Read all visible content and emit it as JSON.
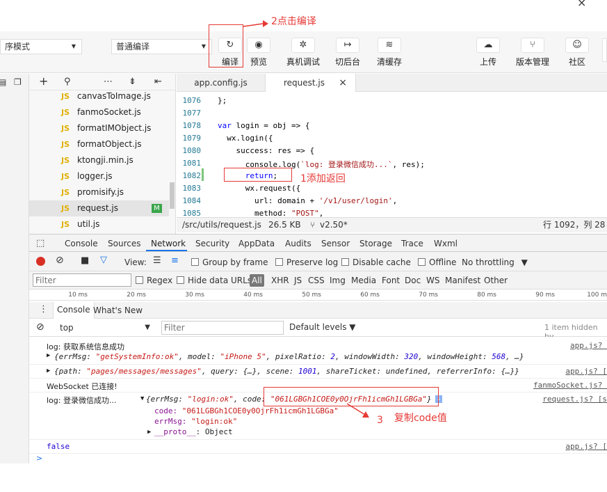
{
  "title_close": "×",
  "toolbar": {
    "mode_select": "序模式",
    "compile_select": "普通编译",
    "buttons": [
      {
        "icon": "↻",
        "label": "编译"
      },
      {
        "icon": "◉",
        "label": "预览"
      },
      {
        "icon": "✲",
        "label": "真机调试"
      },
      {
        "icon": "↦",
        "label": "切后台"
      },
      {
        "icon": "≋",
        "label": "清缓存"
      },
      {
        "icon": "☁",
        "label": "上传"
      },
      {
        "icon": "⑂",
        "label": "版本管理"
      },
      {
        "icon": "☺",
        "label": "社区"
      }
    ]
  },
  "annotations": {
    "a1": "1添加返回",
    "a2": "2点击编译",
    "a3_num": "3",
    "a3_text": "复制code值"
  },
  "filetree": {
    "js_badge": "JS",
    "modified_badge": "M",
    "files": [
      "canvasToImage.js",
      "fanmoSocket.js",
      "formatIMObject.js",
      "formatObject.js",
      "ktongji.min.js",
      "logger.js",
      "promisify.js",
      "request.js",
      "util.js"
    ]
  },
  "tabs": [
    "app.config.js",
    "request.js"
  ],
  "tab_close": "×",
  "editor": {
    "line_numbers": [
      "1076",
      "1077",
      "1078",
      "1079",
      "1080",
      "1081",
      "1082",
      "1083",
      "1084",
      "1085"
    ]
  },
  "statusbar": {
    "path": "/src/utils/request.js",
    "size": "26.5 KB",
    "branch": "v2.50*",
    "position": "行 1092，列 28"
  },
  "devtools_tabs": [
    "Console",
    "Sources",
    "Network",
    "Security",
    "AppData",
    "Audits",
    "Sensor",
    "Storage",
    "Trace",
    "Wxml"
  ],
  "network": {
    "view_label": "View:",
    "group_by_frame": "Group by frame",
    "preserve_log": "Preserve log",
    "disable_cache": "Disable cache",
    "offline": "Offline",
    "throttling": "No throttling",
    "filter_placeholder": "Filter",
    "regex": "Regex",
    "hide_data_urls": "Hide data URLs",
    "types": [
      "All",
      "XHR",
      "JS",
      "CSS",
      "Img",
      "Media",
      "Font",
      "Doc",
      "WS",
      "Manifest",
      "Other"
    ],
    "ticks": [
      "10 ms",
      "20 ms",
      "30 ms",
      "40 ms",
      "50 ms",
      "60 ms",
      "70 ms",
      "80 ms",
      "90 ms",
      "100 m"
    ]
  },
  "drawer_tabs": [
    "Console",
    "What's New"
  ],
  "console_toolbar": {
    "context": "top",
    "filter_placeholder": "Filter",
    "levels": "Default levels",
    "hidden": "1 item hidden by"
  },
  "console": {
    "r1_msg": "log: 获取系统信息成功",
    "r1_src": "app.js? ",
    "r2_a": "{errMsg: ",
    "r2_b": "\"getSystemInfo:ok\"",
    "r2_c": ", model: ",
    "r2_d": "\"iPhone 5\"",
    "r2_e": ", pixelRatio: ",
    "r2_f": "2",
    "r2_g": ", windowWidth: ",
    "r2_h": "320",
    "r2_i": ", windowHeight: ",
    "r2_j": "568",
    "r2_k": ", …}",
    "r3_a": "{path: ",
    "r3_b": "\"pages/messages/messages\"",
    "r3_c": ", query: {…}, scene: ",
    "r3_d": "1001",
    "r3_e": ", shareTicket: undefined, referrerInfo: {…}}",
    "r3_src": "app.js? [",
    "r4_msg": "WebSocket 已连接!",
    "r4_src": "fanmoSocket.js? ",
    "r5_prefix": "log: 登录微信成功...",
    "r5_a": "{errMsg: ",
    "r5_b": "\"login:ok\"",
    "r5_c": ", code: ",
    "r5_d": "\"061LGBGh1COE0y0OjrFh1icmGh1LGBGa\"",
    "r5_e": "}",
    "r5_info": "i",
    "r5_src": "request.js? [s",
    "r5_code_key": "code: ",
    "r5_code_val": "\"061LGBGh1COE0y0OjrFh1icmGh1LGBGa\"",
    "r5_err_key": "errMsg: ",
    "r5_err_val": "\"login:ok\"",
    "r5_proto": "__proto__",
    "r5_proto_val": ": Object",
    "r6_msg": "false",
    "r6_src": "app.js? [",
    "prompt": ">"
  }
}
